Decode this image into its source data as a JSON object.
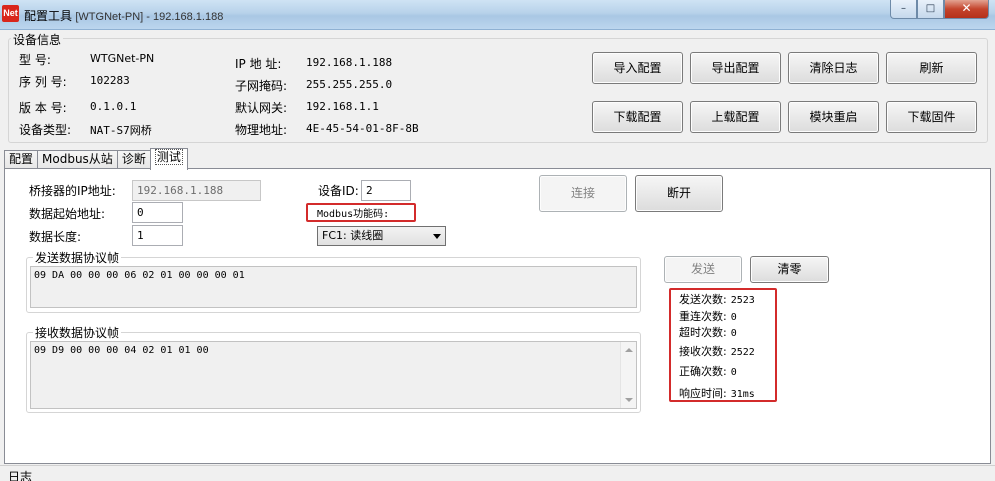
{
  "window": {
    "title": "配置工具",
    "subtitle": "[WTGNet-PN] - 192.168.1.188",
    "icon_text": "Net",
    "minimize": "–",
    "maximize": "□",
    "close": "✕"
  },
  "device_info": {
    "legend": "设备信息",
    "model_label": "型  号:",
    "model_value": "WTGNet-PN",
    "serial_label": "序 列 号:",
    "serial_value": "102283",
    "version_label": "版 本 号:",
    "version_value": "0.1.0.1",
    "type_label": "设备类型:",
    "type_value": "NAT-S7网桥",
    "ip_label": "IP 地 址:",
    "ip_value": "192.168.1.188",
    "mask_label": "子网掩码:",
    "mask_value": "255.255.255.0",
    "gateway_label": "默认网关:",
    "gateway_value": "192.168.1.1",
    "mac_label": "物理地址:",
    "mac_value": "4E-45-54-01-8F-8B"
  },
  "toolbar": {
    "import": "导入配置",
    "export": "导出配置",
    "clear_log": "清除日志",
    "refresh": "刷新",
    "download_config": "下载配置",
    "upload_config": "上载配置",
    "restart": "模块重启",
    "download_firmware": "下载固件"
  },
  "tabs": [
    "配置",
    "Modbus从站",
    "诊断",
    "测试"
  ],
  "test": {
    "bridge_ip_label": "桥接器的IP地址:",
    "bridge_ip_value": "192.168.1.188",
    "start_addr_label": "数据起始地址:",
    "start_addr_value": "0",
    "length_label": "数据长度:",
    "length_value": "1",
    "device_id_label": "设备ID:",
    "device_id_value": "2",
    "func_label": "Modbus功能码:",
    "func_value": "FC1: 读线圈",
    "connect": "连接",
    "disconnect": "断开",
    "send_group": "发送数据协议帧",
    "send_frame": "09 DA 00 00 00 06 02 01 00 00 00 01",
    "recv_group": "接收数据协议帧",
    "recv_frame": "09 D9 00 00 00 04 02 01 01 00",
    "send_btn": "发送",
    "clear_btn": "清零"
  },
  "stats": [
    {
      "label": "发送次数:",
      "value": "2523"
    },
    {
      "label": "重连次数:",
      "value": "0"
    },
    {
      "label": "超时次数:",
      "value": "0"
    },
    {
      "label": "接收次数:",
      "value": "2522"
    },
    {
      "label": "正确次数:",
      "value": "0"
    },
    {
      "label": "响应时间:",
      "value": "31ms"
    }
  ],
  "status": {
    "log_label": "日志"
  },
  "colors": {
    "highlight": "#d32b2b",
    "icon_bg": "#d9261c"
  }
}
